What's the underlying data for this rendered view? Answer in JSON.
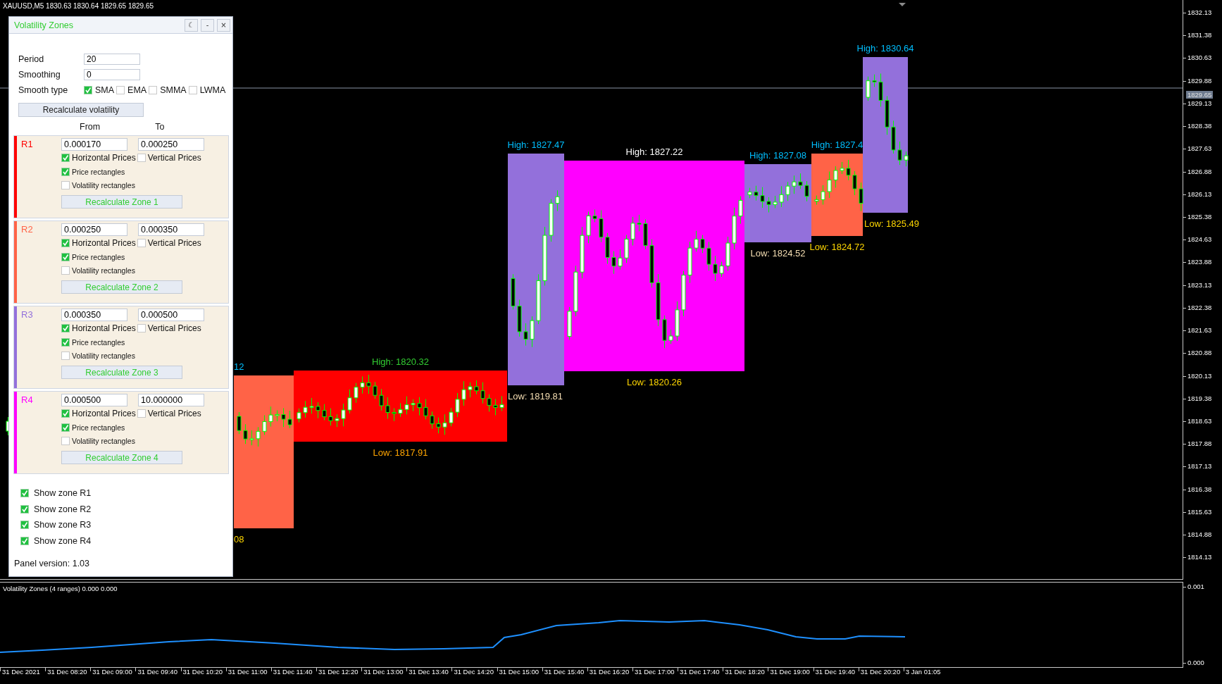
{
  "chart": {
    "symbol_line": "XAUUSD,M5  1830.63 1830.64 1829.65 1829.65",
    "zones": [
      {
        "color": "#ff6347",
        "high": {
          "text": "12",
          "color": "#00bfff"
        },
        "low": {
          "text": "08",
          "color": "#ffd700"
        }
      },
      {
        "color": "#ff0000",
        "high": {
          "text": "High: 1820.32",
          "color": "#32cd32"
        },
        "low": {
          "text": "Low:  1817.91",
          "color": "#ffa500"
        }
      },
      {
        "color": "#9370db",
        "high": {
          "text": "High: 1827.47",
          "color": "#00bfff"
        },
        "low": {
          "text": "Low:  1819.81",
          "color": "#f5deb3"
        }
      },
      {
        "color": "#ff00ff",
        "high": {
          "text": "High: 1827.22",
          "color": "#ffffff"
        },
        "low": {
          "text": "Low:  1820.26",
          "color": "#ffd700"
        }
      },
      {
        "color": "#9370db",
        "high": {
          "text": "High: 1827.08",
          "color": "#00bfff"
        },
        "low": {
          "text": "Low:  1824.52",
          "color": "#f5deb3"
        }
      },
      {
        "color": "#ff6347",
        "high": {
          "text": "High: 1827.4",
          "color": "#00bfff"
        },
        "low": {
          "text": "Low:  1824.72",
          "color": "#ffd700"
        }
      },
      {
        "color": "#9370db",
        "high": {
          "text": "High: 1830.64",
          "color": "#00bfff"
        },
        "low": {
          "text": "Low:  1825.49",
          "color": "#ffd700"
        }
      }
    ],
    "current_price": "1829.65",
    "price_ticks": [
      "1832.13",
      "1831.38",
      "1830.63",
      "1829.88",
      "1829.13",
      "1828.38",
      "1827.63",
      "1826.88",
      "1826.13",
      "1825.38",
      "1824.63",
      "1823.88",
      "1823.13",
      "1822.38",
      "1821.63",
      "1820.88",
      "1820.13",
      "1819.38",
      "1818.63",
      "1817.88",
      "1817.13",
      "1816.38",
      "1815.63",
      "1814.88",
      "1814.13"
    ]
  },
  "indicator": {
    "title": "Volatility Zones (4 ranges) 0.000 0.000",
    "ticks": [
      "0.001",
      "0.000"
    ]
  },
  "time_axis": [
    "31 Dec 2021",
    "31 Dec 08:20",
    "31 Dec 09:00",
    "31 Dec 09:40",
    "31 Dec 10:20",
    "31 Dec 11:00",
    "31 Dec 11:40",
    "31 Dec 12:20",
    "31 Dec 13:00",
    "31 Dec 13:40",
    "31 Dec 14:20",
    "31 Dec 15:00",
    "31 Dec 15:40",
    "31 Dec 16:20",
    "31 Dec 17:00",
    "31 Dec 17:40",
    "31 Dec 18:20",
    "31 Dec 19:00",
    "31 Dec 19:40",
    "31 Dec 20:20",
    "3 Jan 01:05"
  ],
  "panel": {
    "title": "Volatility Zones",
    "title_buttons": [
      "☾",
      "-",
      "×"
    ],
    "period": {
      "label": "Period",
      "value": "20"
    },
    "smoothing": {
      "label": "Smoothing",
      "value": "0"
    },
    "smooth_type": {
      "label": "Smooth type",
      "options": [
        {
          "label": "SMA",
          "checked": true
        },
        {
          "label": "EMA",
          "checked": false
        },
        {
          "label": "SMMA",
          "checked": false
        },
        {
          "label": "LWMA",
          "checked": false
        }
      ]
    },
    "recalc_button": "Recalculate volatility",
    "columns": [
      "From",
      "To"
    ],
    "ranges": [
      {
        "name": "R1",
        "color": "#ff0000",
        "from": "0.000170",
        "to": "0.000250",
        "options": [
          {
            "label": "Horizontal Prices",
            "checked": true
          },
          {
            "label": "Vertical Prices",
            "checked": false
          },
          {
            "label": "Price rectangles",
            "checked": true
          },
          {
            "label": "Volatility rectangles",
            "checked": false
          }
        ],
        "button": "Recalculate Zone 1"
      },
      {
        "name": "R2",
        "color": "#ff6347",
        "from": "0.000250",
        "to": "0.000350",
        "options": [
          {
            "label": "Horizontal Prices",
            "checked": true
          },
          {
            "label": "Vertical Prices",
            "checked": false
          },
          {
            "label": "Price rectangles",
            "checked": true
          },
          {
            "label": "Volatility rectangles",
            "checked": false
          }
        ],
        "button": "Recalculate Zone 2"
      },
      {
        "name": "R3",
        "color": "#9370db",
        "from": "0.000350",
        "to": "0.000500",
        "options": [
          {
            "label": "Horizontal Prices",
            "checked": true
          },
          {
            "label": "Vertical Prices",
            "checked": false
          },
          {
            "label": "Price rectangles",
            "checked": true
          },
          {
            "label": "Volatility rectangles",
            "checked": false
          }
        ],
        "button": "Recalculate Zone 3"
      },
      {
        "name": "R4",
        "color": "#ff00ff",
        "from": "0.000500",
        "to": "10.000000",
        "options": [
          {
            "label": "Horizontal Prices",
            "checked": true
          },
          {
            "label": "Vertical Prices",
            "checked": false
          },
          {
            "label": "Price rectangles",
            "checked": true
          },
          {
            "label": "Volatility rectangles",
            "checked": false
          }
        ],
        "button": "Recalculate Zone 4"
      }
    ],
    "show_zones": [
      {
        "label": "Show zone R1",
        "checked": true
      },
      {
        "label": "Show zone R2",
        "checked": true
      },
      {
        "label": "Show zone R3",
        "checked": true
      },
      {
        "label": "Show zone R4",
        "checked": true
      }
    ],
    "version": "Panel version: 1.03"
  }
}
